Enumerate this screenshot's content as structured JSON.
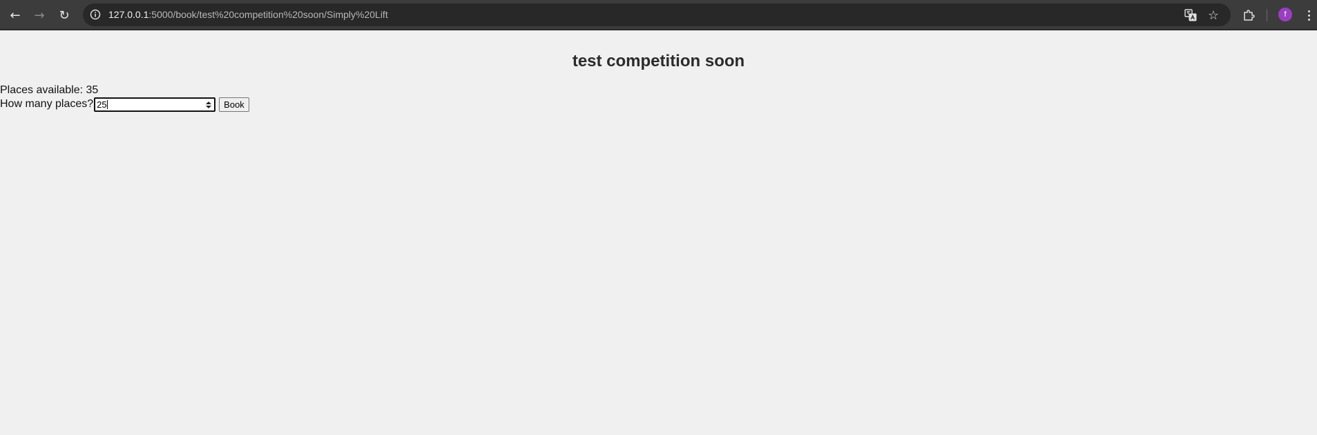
{
  "browser": {
    "url_host": "127.0.0.1",
    "url_rest": ":5000/book/test%20competition%20soon/Simply%20Lift",
    "profile_initial": "f",
    "icons": [
      "back-arrow-icon",
      "forward-arrow-icon",
      "reload-icon",
      "site-info-icon",
      "translate-icon",
      "bookmark-star-icon",
      "extensions-icon",
      "avatar",
      "kebab-menu-icon"
    ]
  },
  "page": {
    "title": "test competition soon",
    "places_label": "Places available: ",
    "places_value": "35",
    "question_label": "How many places?",
    "input_value": "25",
    "book_button_label": "Book"
  },
  "colors": {
    "page_background": "#f0f0f0",
    "browser_toolbar": "#3c3c3c",
    "avatar": "#9b3fc1"
  }
}
